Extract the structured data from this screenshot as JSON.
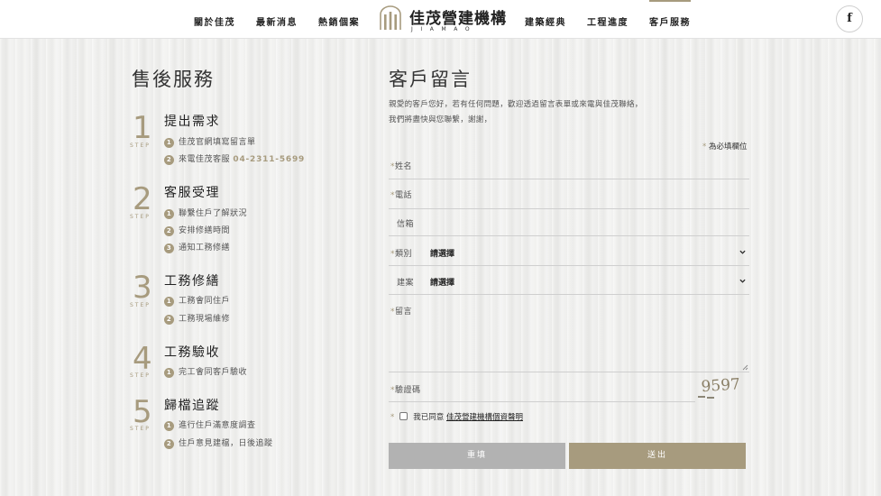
{
  "nav": {
    "left": [
      "關於佳茂",
      "最新消息",
      "熱銷個案"
    ],
    "right": [
      "建築經典",
      "工程進度",
      "客戶服務"
    ],
    "active": "客戶服務"
  },
  "logo": {
    "title": "佳茂營建機構",
    "subtitle": "JIAMAO"
  },
  "social": {
    "facebook": "f"
  },
  "left": {
    "title": "售後服務",
    "step_word": "STEP",
    "steps": [
      {
        "num": "1",
        "title": "提出需求",
        "items": [
          "佳茂官網填寫留言單",
          "來電佳茂客服"
        ],
        "phone": "04-2311-5699"
      },
      {
        "num": "2",
        "title": "客服受理",
        "items": [
          "聯繫住戶了解狀況",
          "安排修繕時間",
          "通知工務修繕"
        ]
      },
      {
        "num": "3",
        "title": "工務修繕",
        "items": [
          "工務會同住戶",
          "工務現場維修"
        ]
      },
      {
        "num": "4",
        "title": "工務驗收",
        "items": [
          "完工會同客戶驗收"
        ]
      },
      {
        "num": "5",
        "title": "歸檔追蹤",
        "items": [
          "進行住戶滿意度調查",
          "住戶意見建檔，日後追蹤"
        ]
      }
    ]
  },
  "form": {
    "title": "客戶留言",
    "intro_line1": "親愛的客戶您好，若有任何問題，歡迎透過留言表單或來電與佳茂聯絡，",
    "intro_line2": "我們將盡快與您聯繫，謝謝，",
    "required_star": "*",
    "required_note": "為必填欄位",
    "fields": {
      "name": {
        "label": "姓名",
        "value": ""
      },
      "phone": {
        "label": "電話",
        "value": ""
      },
      "email": {
        "label": "信箱",
        "value": ""
      },
      "category": {
        "label": "類別",
        "value": "請選擇"
      },
      "project": {
        "label": "建案",
        "value": "請選擇"
      },
      "message": {
        "label": "留言",
        "value": ""
      },
      "captcha": {
        "label": "驗證碼",
        "value": "",
        "image_text": "9597"
      }
    },
    "agree_text": "我已同意",
    "agree_link": "佳茂營建機構個資聲明",
    "reset_label": "重填",
    "submit_label": "送出"
  },
  "colors": {
    "accent": "#a79b7e",
    "reset_button": "#b2b2b2",
    "header_bg": "#ffffff"
  }
}
